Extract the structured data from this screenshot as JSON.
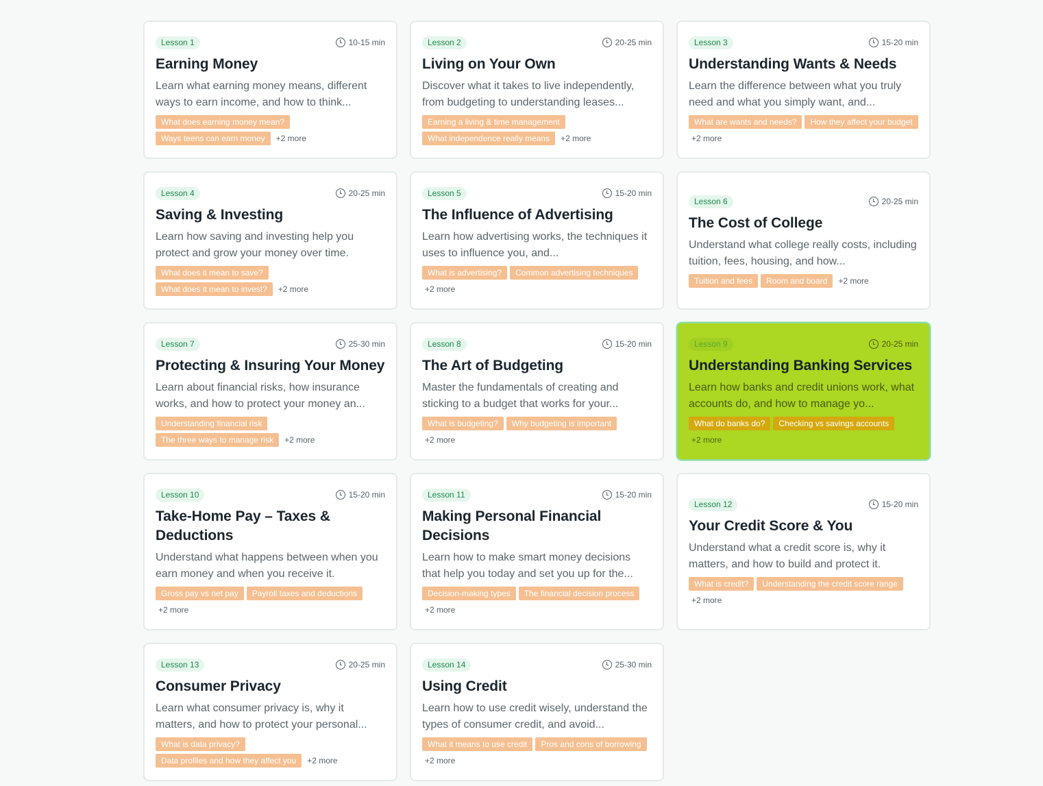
{
  "lessons": [
    {
      "badge": "Lesson 1",
      "duration": "10-15 min",
      "title": "Earning Money",
      "description": "Learn what earning money means, different ways to earn income, and how to think...",
      "tags": [
        "What does earning money mean?",
        "Ways teens can earn money"
      ],
      "more": "+2 more"
    },
    {
      "badge": "Lesson 2",
      "duration": "20-25 min",
      "title": "Living on Your Own",
      "description": "Discover what it takes to live independently, from budgeting to understanding leases...",
      "tags": [
        "Earning a living & time management",
        "What independence really means"
      ],
      "more": "+2 more"
    },
    {
      "badge": "Lesson 3",
      "duration": "15-20 min",
      "title": "Understanding Wants & Needs",
      "description": "Learn the difference between what you truly need and what you simply want, and...",
      "tags": [
        "What are wants and needs?",
        "How they affect your budget"
      ],
      "more": "+2 more"
    },
    {
      "badge": "Lesson 4",
      "duration": "20-25 min",
      "title": "Saving & Investing",
      "description": "Learn how saving and investing help you protect and grow your money over time.",
      "tags": [
        "What does it mean to save?",
        "What does it mean to invest?"
      ],
      "more": "+2 more"
    },
    {
      "badge": "Lesson 5",
      "duration": "15-20 min",
      "title": "The Influence of Advertising",
      "description": "Learn how advertising works, the techniques it uses to influence you, and...",
      "tags": [
        "What is advertising?",
        "Common advertising techniques"
      ],
      "more": "+2 more"
    },
    {
      "badge": "Lesson 6",
      "duration": "20-25 min",
      "title": "The Cost of College",
      "description": "Understand what college really costs, including tuition, fees, housing, and how...",
      "tags": [
        "Tuition and fees",
        "Room and board"
      ],
      "more": "+2 more"
    },
    {
      "badge": "Lesson 7",
      "duration": "25-30 min",
      "title": "Protecting & Insuring Your Money",
      "description": "Learn about financial risks, how insurance works, and how to protect your money an...",
      "tags": [
        "Understanding financial risk",
        "The three ways to manage risk"
      ],
      "more": "+2 more"
    },
    {
      "badge": "Lesson 8",
      "duration": "15-20 min",
      "title": "The Art of Budgeting",
      "description": "Master the fundamentals of creating and sticking to a budget that works for your...",
      "tags": [
        "What is budgeting?",
        "Why budgeting is important"
      ],
      "more": "+2 more"
    },
    {
      "badge": "Lesson 9",
      "duration": "20-25 min",
      "title": "Understanding Banking Services",
      "description": "Learn how banks and credit unions work, what accounts do, and how to manage yo...",
      "tags": [
        "What do banks do?",
        "Checking vs savings accounts"
      ],
      "more": "+2 more"
    },
    {
      "badge": "Lesson 10",
      "duration": "15-20 min",
      "title": "Take-Home Pay – Taxes & Deductions",
      "description": "Understand what happens between when you earn money and when you receive it.",
      "tags": [
        "Gross pay vs net pay",
        "Payroll taxes and deductions"
      ],
      "more": "+2 more"
    },
    {
      "badge": "Lesson 11",
      "duration": "15-20 min",
      "title": "Making Personal Financial Decisions",
      "description": "Learn how to make smart money decisions that help you today and set you up for the...",
      "tags": [
        "Decision-making types",
        "The financial decision process"
      ],
      "more": "+2 more"
    },
    {
      "badge": "Lesson 12",
      "duration": "15-20 min",
      "title": "Your Credit Score & You",
      "description": "Understand what a credit score is, why it matters, and how to build and protect it.",
      "tags": [
        "What is credit?",
        "Understanding the credit score range"
      ],
      "more": "+2 more"
    },
    {
      "badge": "Lesson 13",
      "duration": "20-25 min",
      "title": "Consumer Privacy",
      "description": "Learn what consumer privacy is, why it matters, and how to protect your personal...",
      "tags": [
        "What is data privacy?",
        "Data profiles and how they affect you"
      ],
      "more": "+2 more"
    },
    {
      "badge": "Lesson 14",
      "duration": "25-30 min",
      "title": "Using Credit",
      "description": "Learn how to use credit wisely, understand the types of consumer credit, and avoid...",
      "tags": [
        "What it means to use credit",
        "Pros and cons of borrowing"
      ],
      "more": "+2 more"
    }
  ],
  "active_lesson": "Lesson 9",
  "colors": {
    "active_card": "#acd723",
    "tag": "#f5bf91",
    "badge_text": "#1f8a4c"
  },
  "icons": {
    "duration": "clock-icon"
  }
}
